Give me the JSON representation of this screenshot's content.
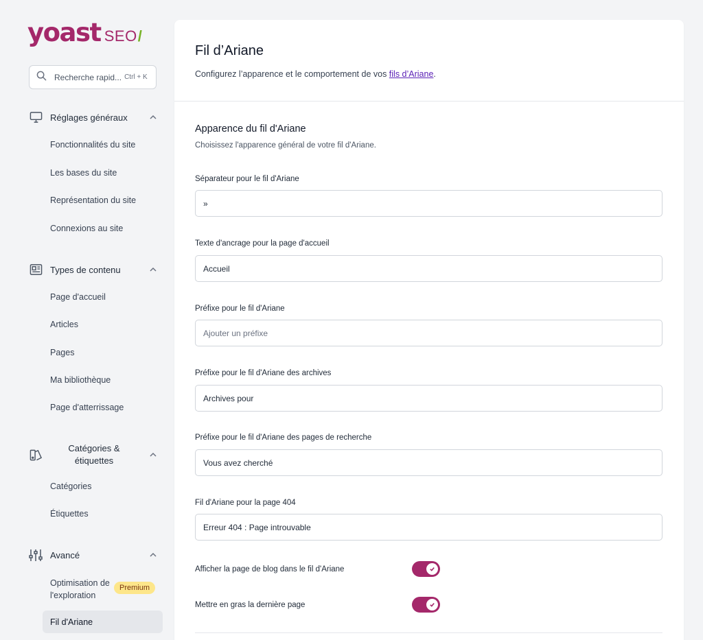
{
  "brand": {
    "logo_main": "yoast",
    "logo_seo": "SEO",
    "logo_slash": "/"
  },
  "search": {
    "text": "Recherche rapid...",
    "shortcut": "Ctrl + K"
  },
  "sidebar": {
    "groups": [
      {
        "label": "Réglages généraux",
        "icon": "desktop-icon",
        "items": [
          "Fonctionnalités du site",
          "Les bases du site",
          "Représentation du site",
          "Connexions au site"
        ]
      },
      {
        "label": "Types de contenu",
        "icon": "document-icon",
        "items": [
          "Page d'accueil",
          "Articles",
          "Pages",
          "Ma bibliothèque",
          "Page d'atterrissage"
        ]
      },
      {
        "label": "Catégories & étiquettes",
        "icon": "tags-icon",
        "items": [
          "Catégories",
          "Étiquettes"
        ]
      },
      {
        "label": "Avancé",
        "icon": "sliders-icon",
        "items": [
          "Optimisation de l'exploration",
          "Fil d'Ariane"
        ]
      }
    ],
    "premium_badge": "Premium",
    "active_item": "Fil d'Ariane"
  },
  "header": {
    "title": "Fil d’Ariane",
    "description_prefix": "Configurez l’apparence et le comportement de vos ",
    "description_link": "fils d’Ariane",
    "description_suffix": "."
  },
  "section": {
    "title": "Apparence du fil d'Ariane",
    "description": "Choisissez l'apparence général de votre fil d'Ariane."
  },
  "fields": [
    {
      "label": "Séparateur pour le fil d'Ariane",
      "value": "»",
      "placeholder": ""
    },
    {
      "label": "Texte d'ancrage pour la page d'accueil",
      "value": "Accueil",
      "placeholder": ""
    },
    {
      "label": "Préfixe pour le fil d'Ariane",
      "value": "",
      "placeholder": "Ajouter un préfixe"
    },
    {
      "label": "Préfixe pour le fil d'Ariane des archives",
      "value": "Archives pour",
      "placeholder": ""
    },
    {
      "label": "Préfixe pour le fil d'Ariane des pages de recherche",
      "value": "Vous avez cherché",
      "placeholder": ""
    },
    {
      "label": "Fil d'Ariane pour la page 404",
      "value": "Erreur 404 : Page introuvable",
      "placeholder": ""
    }
  ],
  "toggles": [
    {
      "label": "Afficher la page de blog dans le fil d'Ariane",
      "on": true
    },
    {
      "label": "Mettre en gras la dernière page",
      "on": true
    }
  ],
  "colors": {
    "brand": "#a4286a",
    "accent_green": "#77b227",
    "premium_bg": "#fde68a",
    "link": "#5b21b6"
  }
}
